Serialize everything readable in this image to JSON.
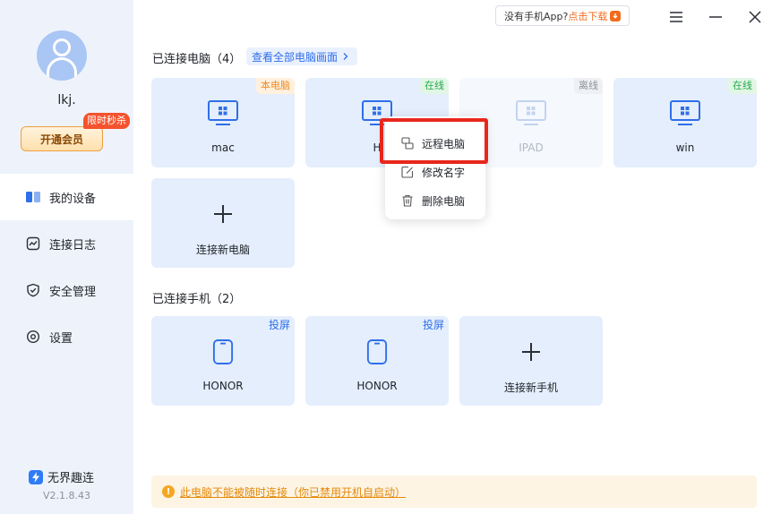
{
  "header": {
    "download_question": "没有手机App?",
    "download_link": "点击下载"
  },
  "sidebar": {
    "username": "lkj.",
    "vip_button": "开通会员",
    "promo_tag": "限时秒杀",
    "nav": [
      {
        "label": "我的设备",
        "icon": "devices-icon"
      },
      {
        "label": "连接日志",
        "icon": "log-icon"
      },
      {
        "label": "安全管理",
        "icon": "shield-icon"
      },
      {
        "label": "设置",
        "icon": "settings-icon"
      }
    ],
    "brand": "无界趣连",
    "version": "V2.1.8.43"
  },
  "computers": {
    "title": "已连接电脑（4）",
    "view_all": "查看全部电脑画面",
    "devices": [
      {
        "name": "mac",
        "status": "本电脑"
      },
      {
        "name": "H",
        "status": "在线"
      },
      {
        "name": "IPAD",
        "status": "离线"
      },
      {
        "name": "win",
        "status": "在线"
      }
    ],
    "add_label": "连接新电脑"
  },
  "context_menu": {
    "items": [
      "远程电脑",
      "修改名字",
      "删除电脑"
    ]
  },
  "phones": {
    "title": "已连接手机（2）",
    "devices": [
      {
        "name": "HONOR",
        "action": "投屏"
      },
      {
        "name": "HONOR",
        "action": "投屏"
      }
    ],
    "add_label": "连接新手机"
  },
  "notice": {
    "text": "此电脑不能被随时连接（你已禁用开机自启动）"
  },
  "colors": {
    "accent": "#2f6fe8",
    "card_bg": "#e4eefc",
    "sidebar_bg": "#eef3fb",
    "highlight": "#e8271c",
    "warning": "#e48a0c"
  }
}
